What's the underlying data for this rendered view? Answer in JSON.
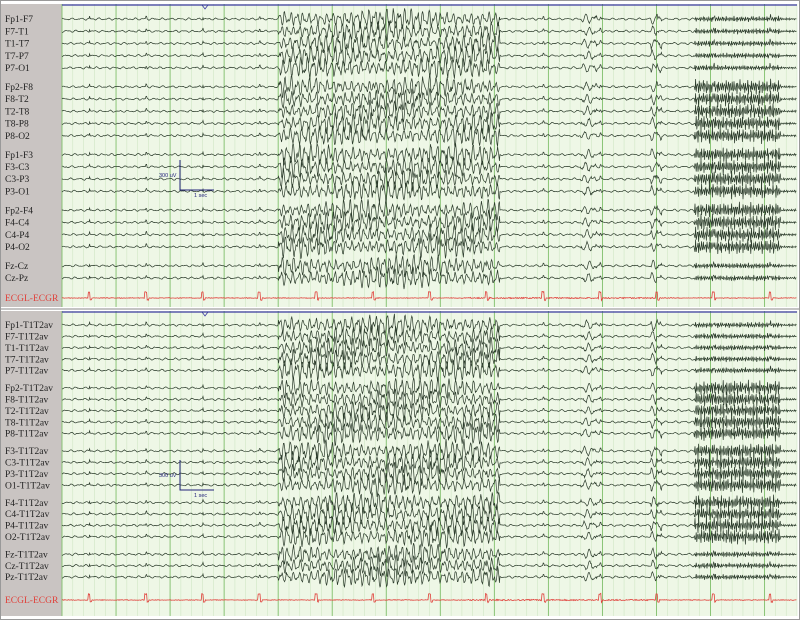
{
  "montages": [
    {
      "id": "bipolar",
      "groups": [
        [
          "Fp1-F7",
          "F7-T1",
          "T1-T7",
          "T7-P7",
          "P7-O1"
        ],
        [
          "Fp2-F8",
          "F8-T2",
          "T2-T8",
          "T8-P8",
          "P8-O2"
        ],
        [
          "Fp1-F3",
          "F3-C3",
          "C3-P3",
          "P3-O1"
        ],
        [
          "Fp2-F4",
          "F4-C4",
          "C4-P4",
          "P4-O2"
        ],
        [
          "Fz-Cz",
          "Cz-Pz"
        ]
      ],
      "ecg_label": "ECGL-ECGR",
      "calibration": {
        "amplitude_label": "300 uV",
        "time_label": "1 sec"
      }
    },
    {
      "id": "average-reference",
      "groups": [
        [
          "Fp1-T1T2av",
          "F7-T1T2av",
          "T1-T1T2av",
          "T7-T1T2av",
          "P7-T1T2av"
        ],
        [
          "Fp2-T1T2av",
          "F8-T1T2av",
          "T2-T1T2av",
          "T8-T1T2av",
          "P8-T1T2av"
        ],
        [
          "F3-T1T2av",
          "C3-T1T2av",
          "P3-T1T2av",
          "O1-T1T2av"
        ],
        [
          "F4-T1T2av",
          "C4-T1T2av",
          "P4-T1T2av",
          "O2-T1T2av"
        ],
        [
          "Fz-T1T2av",
          "Cz-T1T2av",
          "Pz-T1T2av"
        ]
      ],
      "ecg_label": "ECGL-ECGR",
      "calibration": {
        "amplitude_label": "300 uV",
        "time_label": "1 sec"
      }
    }
  ],
  "colors": {
    "trace": "#2a3a2a",
    "ecg": "#e0403a",
    "grid_background": "#eef7e6",
    "grid_major": "#7fbf6a",
    "grid_minor": "#c9e3bd",
    "label_panel": "#c9c4c2",
    "top_border": "#3a3aa0",
    "calibration": "#23237a"
  },
  "recording": {
    "seizure_bursts_seconds": [
      [
        4.0,
        8.1
      ],
      [
        11.9,
        13.0
      ]
    ],
    "high_frequency_seconds": [
      11.7,
      13.3
    ]
  }
}
